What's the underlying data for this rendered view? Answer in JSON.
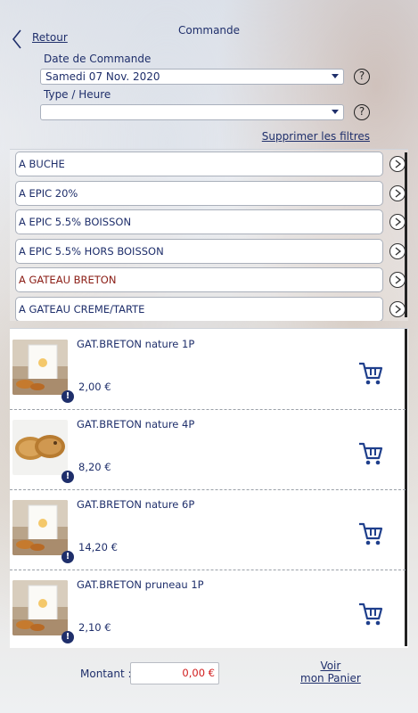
{
  "header": {
    "title": "Commande",
    "back_label": "Retour"
  },
  "filters": {
    "date_label": "Date de Commande",
    "date_value": "Samedi 07 Nov. 2020",
    "type_label": "Type / Heure",
    "type_value": "",
    "clear_label": "Supprimer les filtres",
    "help_glyph": "?"
  },
  "categories": [
    {
      "label": "A BUCHE",
      "active": false
    },
    {
      "label": "A EPIC 20%",
      "active": false
    },
    {
      "label": "A EPIC 5.5% BOISSON",
      "active": false
    },
    {
      "label": "A EPIC 5.5% HORS BOISSON",
      "active": false
    },
    {
      "label": "A GATEAU BRETON",
      "active": true
    },
    {
      "label": "A GATEAU CREME/TARTE",
      "active": false
    }
  ],
  "products": [
    {
      "name": "GAT.BRETON nature 1P",
      "price": "2,00 €",
      "image": "bagged-cake"
    },
    {
      "name": "GAT.BRETON nature 4P",
      "price": "8,20 €",
      "image": "two-round-cakes"
    },
    {
      "name": "GAT.BRETON nature 6P",
      "price": "14,20 €",
      "image": "bagged-cake"
    },
    {
      "name": "GAT.BRETON pruneau 1P",
      "price": "2,10 €",
      "image": "bagged-cake"
    }
  ],
  "footer": {
    "amount_label": "Montant :",
    "amount_value": "0,00 €",
    "cart_link_line1": "Voir",
    "cart_link_line2": "mon Panier"
  },
  "icons": {
    "back": "chevron-left-icon",
    "help": "help-circle-icon",
    "category_arrow": "chevron-right-circle-icon",
    "warning": "exclamation-badge-icon",
    "cart": "add-to-cart-icon"
  },
  "colors": {
    "text": "#1f2f6b",
    "active_category": "#8a1c14",
    "amount": "#d11b1b"
  }
}
